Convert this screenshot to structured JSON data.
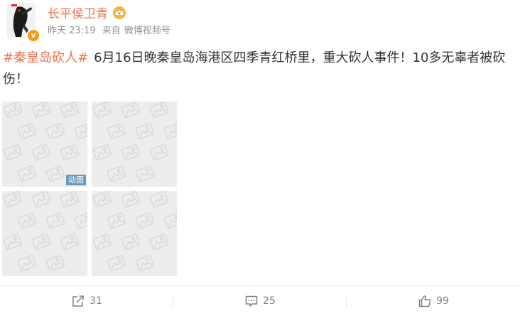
{
  "post": {
    "author": "长平侯卫青",
    "time": "昨天 23:19",
    "source_prefix": "来自",
    "source": "微博视频号",
    "verified_mark": "v",
    "topic": "#秦皇岛砍人#",
    "text": "6月16日晚秦皇岛海港区四季青红桥里，重大砍人事件！10多无辜者被砍伤！",
    "gif_label": "动图"
  },
  "actions": {
    "repost_count": "31",
    "comment_count": "25",
    "like_count": "99"
  },
  "colors": {
    "accent": "#eb7350",
    "meta": "#939393",
    "verified": "#f69a12",
    "gif_badge": "#6d97bf"
  },
  "icons": {
    "repost": "share-arrow-icon",
    "comment": "comment-bubble-icon",
    "like": "thumbs-up-icon",
    "placeholder": "image-placeholder-icon",
    "member": "crown-icon"
  }
}
